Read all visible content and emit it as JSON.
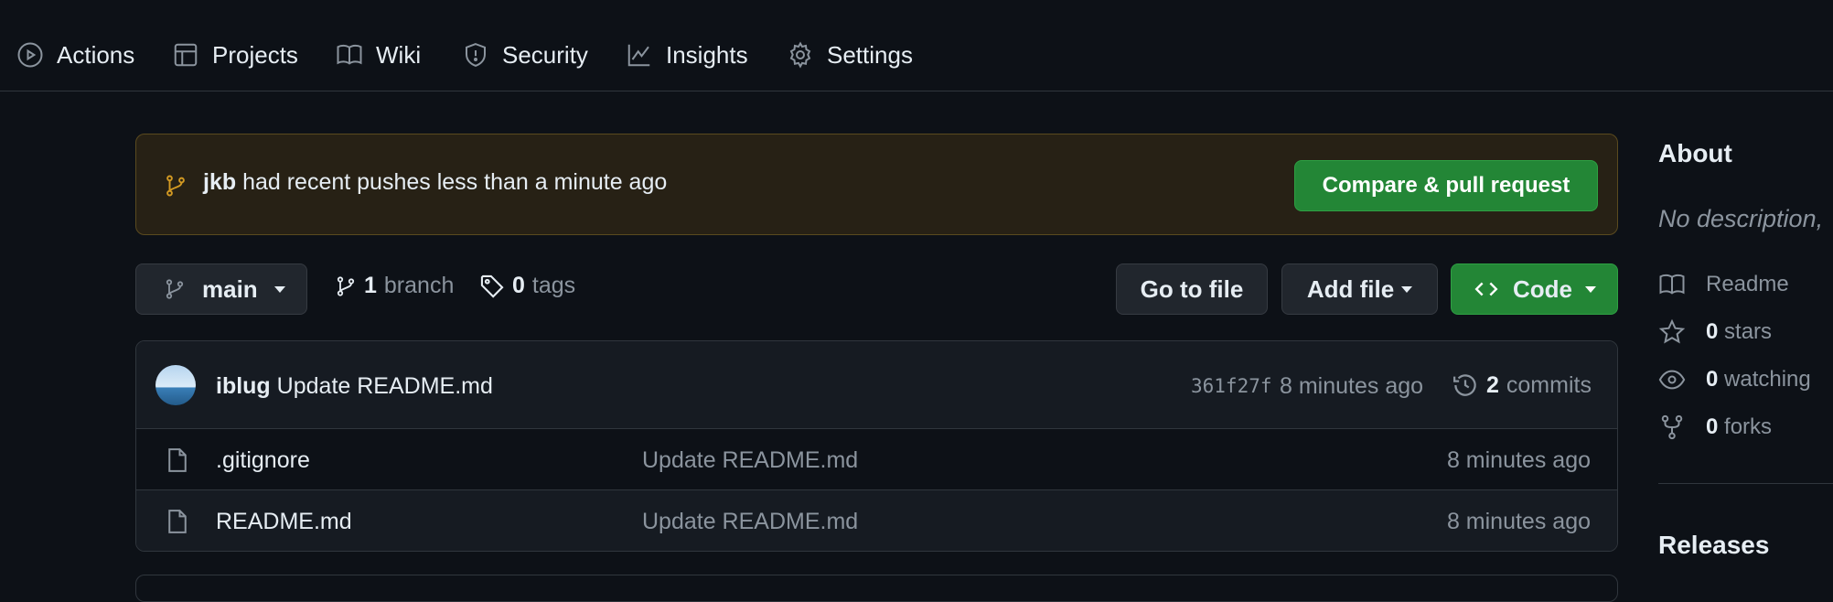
{
  "nav": {
    "items": [
      {
        "label": "Actions",
        "icon": "play-circle-icon"
      },
      {
        "label": "Projects",
        "icon": "table-icon"
      },
      {
        "label": "Wiki",
        "icon": "book-icon"
      },
      {
        "label": "Security",
        "icon": "shield-icon"
      },
      {
        "label": "Insights",
        "icon": "graph-icon"
      },
      {
        "label": "Settings",
        "icon": "gear-icon"
      }
    ]
  },
  "banner": {
    "user": "jkb",
    "message": " had recent pushes less than a minute ago",
    "button_label": "Compare & pull request"
  },
  "toolbar": {
    "branch_name": "main",
    "branch_count": "1",
    "branch_word": "branch",
    "tag_count": "0",
    "tag_word": "tags",
    "goto_label": "Go to file",
    "addfile_label": "Add file",
    "code_label": "Code"
  },
  "latest_commit": {
    "author": "iblug",
    "message": "Update README.md",
    "sha": "361f27f",
    "age": "8 minutes ago",
    "commit_count": "2",
    "commit_word": "commits"
  },
  "files": [
    {
      "name": ".gitignore",
      "message": "Update README.md",
      "age": "8 minutes ago"
    },
    {
      "name": "README.md",
      "message": "Update README.md",
      "age": "8 minutes ago"
    }
  ],
  "sidebar": {
    "about_heading": "About",
    "description": "No description,",
    "readme_label": "Readme",
    "stars_count": "0",
    "stars_word": "stars",
    "watching_count": "0",
    "watching_word": "watching",
    "forks_count": "0",
    "forks_word": "forks",
    "releases_heading": "Releases"
  },
  "colors": {
    "background": "#0d1117",
    "accent_green": "#238636",
    "banner_bg": "#272115",
    "banner_icon": "#d29922",
    "muted_text": "#8b949e"
  }
}
